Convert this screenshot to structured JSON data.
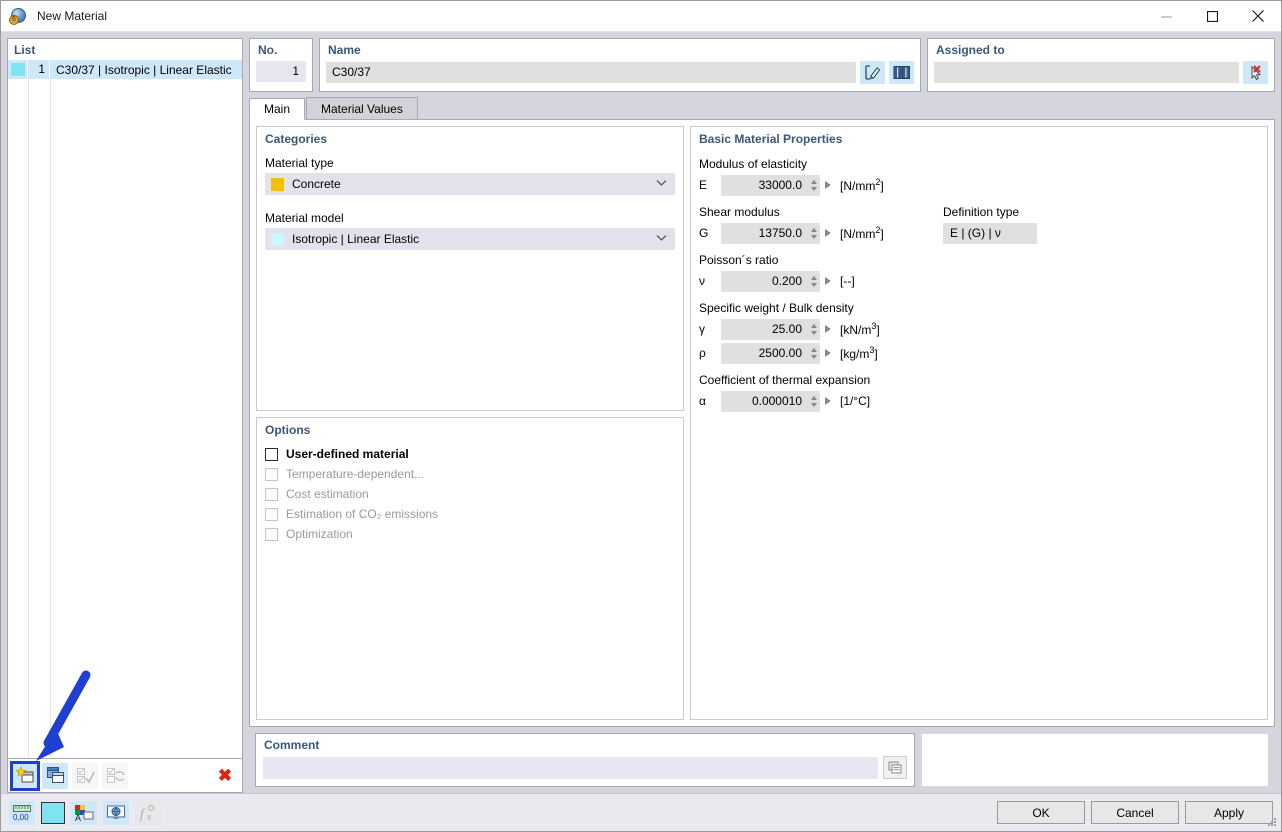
{
  "window": {
    "title": "New Material",
    "icon": "material-ball-icon",
    "minimize_label": "Minimize",
    "maximize_label": "Maximize",
    "close_label": "Close"
  },
  "list": {
    "header": "List",
    "rows": [
      {
        "no": "1",
        "name": "C30/37 | Isotropic | Linear Elastic",
        "color": "#7fe3f0"
      }
    ],
    "toolbar": [
      {
        "name": "new-material-button",
        "icon": "new-window-star-icon",
        "enabled": true,
        "highlighted": true
      },
      {
        "name": "copy-material-button",
        "icon": "copy-windows-icon",
        "enabled": true,
        "highlighted": false
      },
      {
        "name": "select-all-button",
        "icon": "checkboxes-check-icon",
        "enabled": false,
        "highlighted": false
      },
      {
        "name": "invert-selection-button",
        "icon": "checkboxes-swap-icon",
        "enabled": false,
        "highlighted": false
      },
      {
        "name": "delete-material-button",
        "icon": "red-x-icon",
        "enabled": true,
        "highlighted": false
      }
    ]
  },
  "number_group": {
    "title": "No.",
    "value": "1"
  },
  "name_group": {
    "title": "Name",
    "value": "C30/37",
    "edit_button_icon": "edit-pencil-box-icon",
    "library_button_icon": "book-library-icon"
  },
  "assigned_group": {
    "title": "Assigned to",
    "value": "",
    "clear_button_icon": "cursor-red-x-icon"
  },
  "tabs": [
    {
      "label": "Main",
      "active": true
    },
    {
      "label": "Material Values",
      "active": false
    }
  ],
  "categories": {
    "title": "Categories",
    "material_type": {
      "label": "Material type",
      "value": "Concrete",
      "swatch": "#f5c000"
    },
    "material_model": {
      "label": "Material model",
      "value": "Isotropic | Linear Elastic",
      "swatch": "#ccf7fb"
    }
  },
  "options": {
    "title": "Options",
    "items": [
      {
        "label": "User-defined material",
        "checked": false,
        "enabled": true
      },
      {
        "label": "Temperature-dependent...",
        "checked": false,
        "enabled": false
      },
      {
        "label": "Cost estimation",
        "checked": false,
        "enabled": false
      },
      {
        "label": "Estimation of CO₂ emissions",
        "checked": false,
        "enabled": false
      },
      {
        "label": "Optimization",
        "checked": false,
        "enabled": false
      }
    ]
  },
  "properties": {
    "title": "Basic Material Properties",
    "modulus_of_elasticity": {
      "caption": "Modulus of elasticity",
      "symbol": "E",
      "value": "33000.0",
      "unit": "[N/mm²]"
    },
    "shear_modulus": {
      "caption": "Shear modulus",
      "symbol": "G",
      "value": "13750.0",
      "unit": "[N/mm²]"
    },
    "definition_type": {
      "caption": "Definition type",
      "value": "E | (G) | ν"
    },
    "poissons_ratio": {
      "caption": "Poisson´s ratio",
      "symbol": "ν",
      "value": "0.200",
      "unit": "[--]"
    },
    "specific_weight": {
      "caption": "Specific weight / Bulk density",
      "gamma": {
        "symbol": "γ",
        "value": "25.00",
        "unit": "[kN/m³]"
      },
      "rho": {
        "symbol": "ρ",
        "value": "2500.00",
        "unit": "[kg/m³]"
      }
    },
    "thermal_expansion": {
      "caption": "Coefficient of thermal expansion",
      "symbol": "α",
      "value": "0.000010",
      "unit": "[1/°C]"
    }
  },
  "comment": {
    "title": "Comment",
    "value": "",
    "placeholder": "",
    "picker_button_icon": "comment-templates-icon"
  },
  "footer": {
    "status_buttons": [
      {
        "name": "decimal-places-button",
        "icon": "decimal-places-icon",
        "enabled": true
      },
      {
        "name": "color-swatch-button",
        "icon": "color-swatch-icon",
        "enabled": true,
        "color": "#7fe3f0"
      },
      {
        "name": "display-properties-button",
        "icon": "color-font-icon",
        "enabled": true
      },
      {
        "name": "rendering-button",
        "icon": "monitor-globe-icon",
        "enabled": true
      },
      {
        "name": "formula-button",
        "icon": "function-fx-icon",
        "enabled": false
      }
    ],
    "ok_label": "OK",
    "cancel_label": "Cancel",
    "apply_label": "Apply"
  },
  "annotation": {
    "arrow_color": "#1f3fd0",
    "points_to": "new-material-button"
  }
}
